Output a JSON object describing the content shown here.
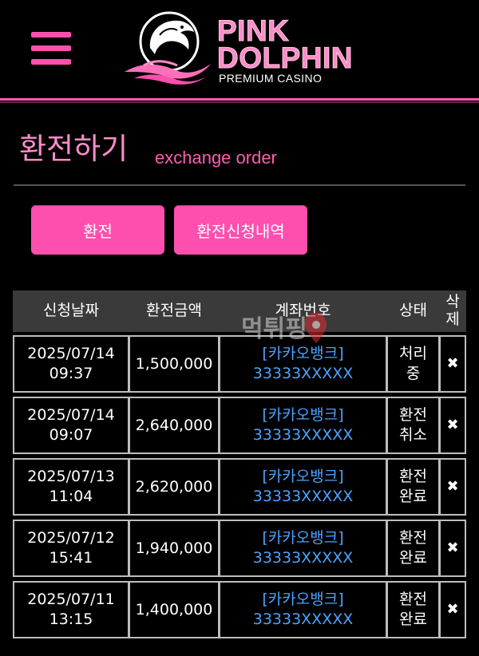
{
  "header": {
    "logo_line1": "PINK",
    "logo_line2": "DOLPHIN",
    "logo_subtitle": "PREMIUM CASINO",
    "menu_icon": "hamburger-menu-icon",
    "accent_color": "#ff4fae"
  },
  "page": {
    "title_ko": "환전하기",
    "title_en": "exchange order"
  },
  "buttons": {
    "exchange": "환전",
    "history": "환전신청내역"
  },
  "table": {
    "headers": {
      "date": "신청날짜",
      "amount": "환전금액",
      "account": "계좌번호",
      "status": "상태",
      "delete_line1": "삭",
      "delete_line2": "제"
    },
    "rows": [
      {
        "date": "2025/07/14",
        "time": "09:37",
        "amount": "1,500,000",
        "bank": "[카카오뱅크]",
        "account": "33333XXXXX",
        "status1": "처리",
        "status2": "중",
        "delete": "✖"
      },
      {
        "date": "2025/07/14",
        "time": "09:07",
        "amount": "2,640,000",
        "bank": "[카카오뱅크]",
        "account": "33333XXXXX",
        "status1": "환전",
        "status2": "취소",
        "delete": "✖"
      },
      {
        "date": "2025/07/13",
        "time": "11:04",
        "amount": "2,620,000",
        "bank": "[카카오뱅크]",
        "account": "33333XXXXX",
        "status1": "환전",
        "status2": "완료",
        "delete": "✖"
      },
      {
        "date": "2025/07/12",
        "time": "15:41",
        "amount": "1,940,000",
        "bank": "[카카오뱅크]",
        "account": "33333XXXXX",
        "status1": "환전",
        "status2": "완료",
        "delete": "✖"
      },
      {
        "date": "2025/07/11",
        "time": "13:15",
        "amount": "1,400,000",
        "bank": "[카카오뱅크]",
        "account": "33333XXXXX",
        "status1": "환전",
        "status2": "완료",
        "delete": "✖"
      }
    ]
  },
  "watermark": {
    "text": "먹튀핑",
    "icon": "location-pin-icon"
  }
}
